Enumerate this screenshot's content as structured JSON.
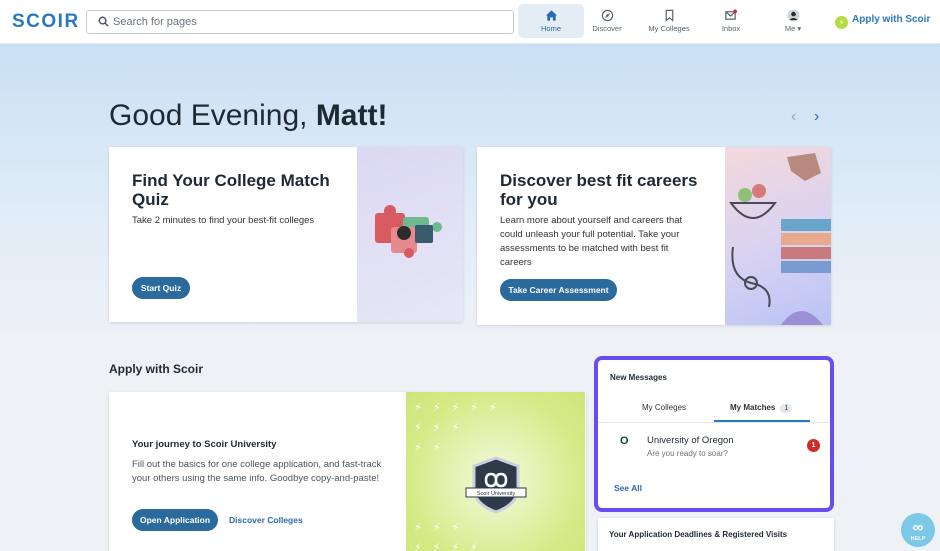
{
  "header": {
    "logo": "SCOIR",
    "search_placeholder": "Search for pages",
    "nav": [
      {
        "label": "Home",
        "icon": "home-icon",
        "active": true
      },
      {
        "label": "Discover",
        "icon": "compass-icon",
        "active": false
      },
      {
        "label": "My Colleges",
        "icon": "bookmark-icon",
        "active": false
      },
      {
        "label": "Inbox",
        "icon": "mail-icon",
        "active": false
      },
      {
        "label": "Me",
        "icon": "avatar-icon",
        "active": false
      }
    ],
    "apply_link": "Apply with Scoir"
  },
  "hero": {
    "greeting_prefix": "Good Evening, ",
    "greeting_name": "Matt!"
  },
  "cards": {
    "quiz": {
      "title": "Find Your College Match Quiz",
      "body": "Take 2 minutes to find your best-fit colleges",
      "button": "Start Quiz"
    },
    "career": {
      "title": "Discover best fit careers for you",
      "body": "Learn more about yourself and careers that could unleash your full potential. Take your assessments to be matched with best fit careers",
      "button": "Take Career Assessment"
    }
  },
  "apply_section": {
    "title": "Apply with Scoir",
    "card_title": "Your journey to Scoir University",
    "card_body": "Fill out the basics for one college application, and fast-track your others using the same info. Goodbye copy-and-paste!",
    "primary_button": "Open Application",
    "secondary_link": "Discover Colleges",
    "badge_text": "Scoir University"
  },
  "messages": {
    "title": "New Messages",
    "tabs": [
      {
        "label": "My Colleges",
        "active": false
      },
      {
        "label": "My Matches",
        "active": true,
        "count": "1"
      }
    ],
    "items": [
      {
        "logo": "O",
        "name": "University of Oregon",
        "preview": "Are you ready to soar?",
        "unread": "1"
      }
    ],
    "see_all": "See All"
  },
  "deadlines": {
    "title": "Your Application Deadlines & Registered Visits"
  },
  "help": {
    "label": "HELP"
  },
  "colors": {
    "brand": "#2a78bf",
    "button": "#2a6a9c",
    "highlight_border": "#6a4df0",
    "unread_badge": "#d12b2b"
  }
}
